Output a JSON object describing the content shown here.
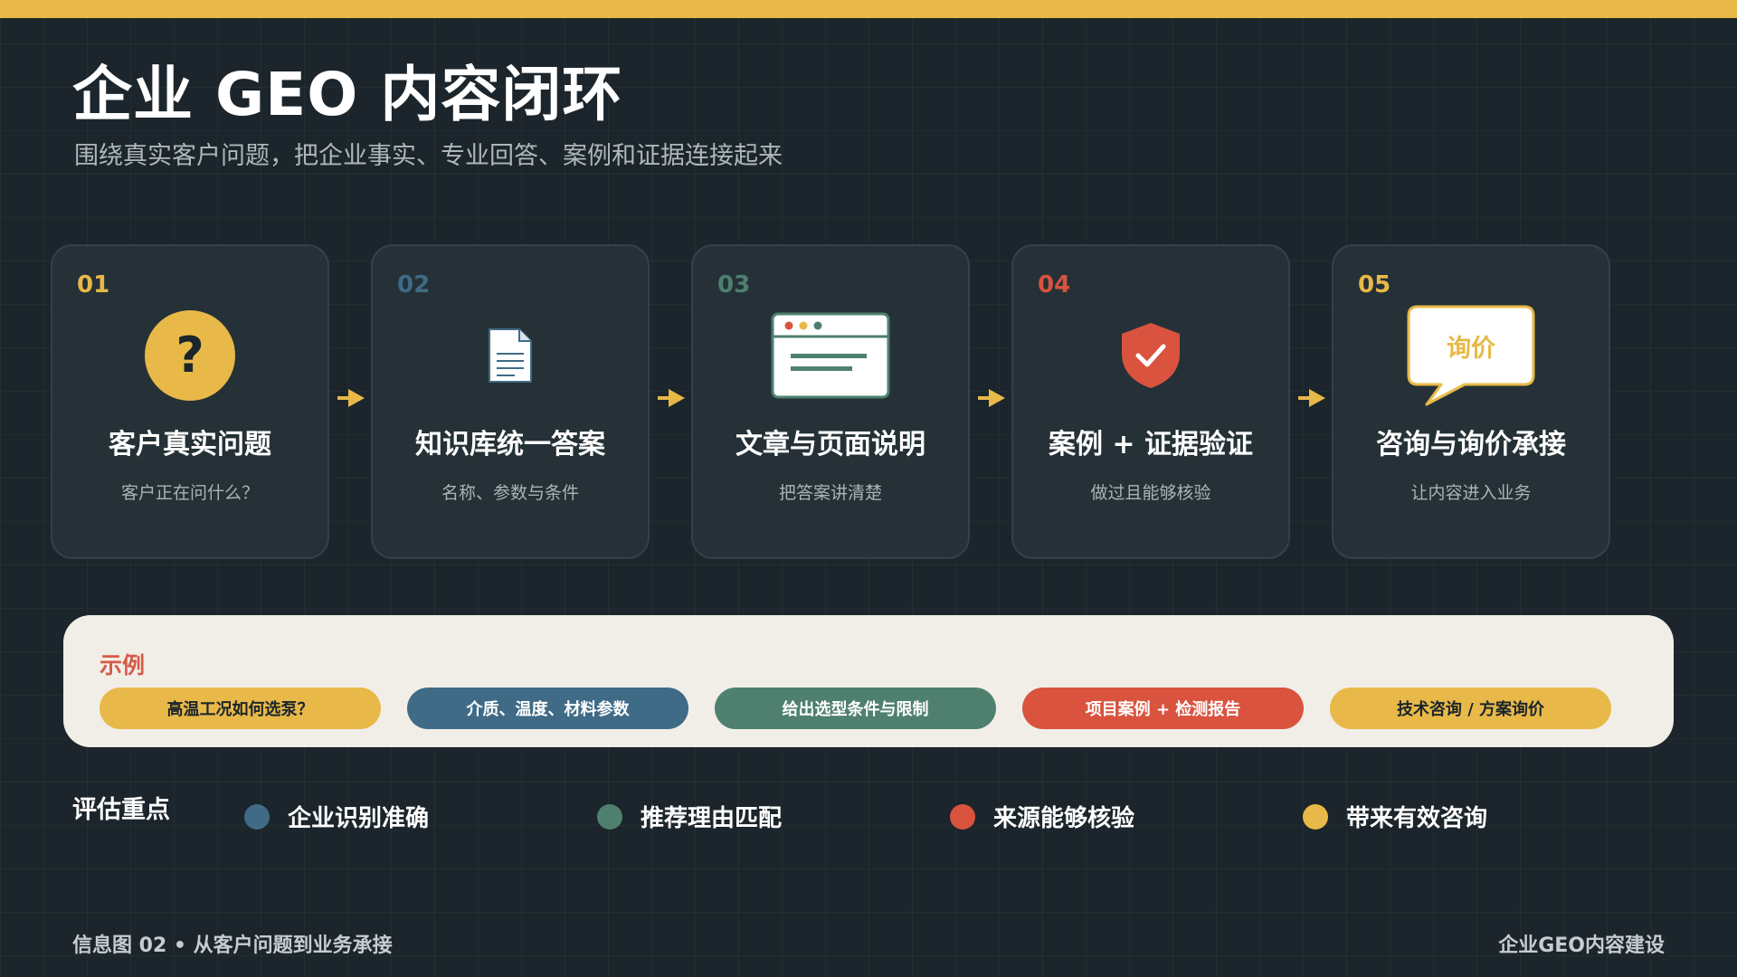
{
  "header": {
    "title": "企业 GEO 内容闭环",
    "subtitle": "围绕真实客户问题，把企业事实、专业回答、案例和证据连接起来"
  },
  "colors": {
    "yellow": "#e8b948",
    "blue": "#3f6b87",
    "green": "#4f806f",
    "red": "#d9533f",
    "background": "#1b252b",
    "card": "#253137"
  },
  "steps": [
    {
      "num": "01",
      "title": "客户真实问题",
      "desc": "客户正在问什么？",
      "icon": "question-icon"
    },
    {
      "num": "02",
      "title": "知识库统一答案",
      "desc": "名称、参数与条件",
      "icon": "document-icon"
    },
    {
      "num": "03",
      "title": "文章与页面说明",
      "desc": "把答案讲清楚",
      "icon": "browser-window-icon"
    },
    {
      "num": "04",
      "title": "案例 + 证据验证",
      "desc": "做过且能够核验",
      "icon": "shield-check-icon"
    },
    {
      "num": "05",
      "title": "咨询与询价承接",
      "desc": "让内容进入业务",
      "icon": "speech-bubble-icon",
      "icon_text": "询价"
    }
  ],
  "example": {
    "label": "示例",
    "pills": [
      "高温工况如何选泵？",
      "介质、温度、材料参数",
      "给出选型条件与限制",
      "项目案例 + 检测报告",
      "技术咨询 / 方案询价"
    ]
  },
  "evaluation": {
    "label": "评估重点",
    "items": [
      "企业识别准确",
      "推荐理由匹配",
      "来源能够核验",
      "带来有效咨询"
    ]
  },
  "footer": {
    "left": "信息图 02 • 从客户问题到业务承接",
    "right": "企业GEO内容建设"
  }
}
